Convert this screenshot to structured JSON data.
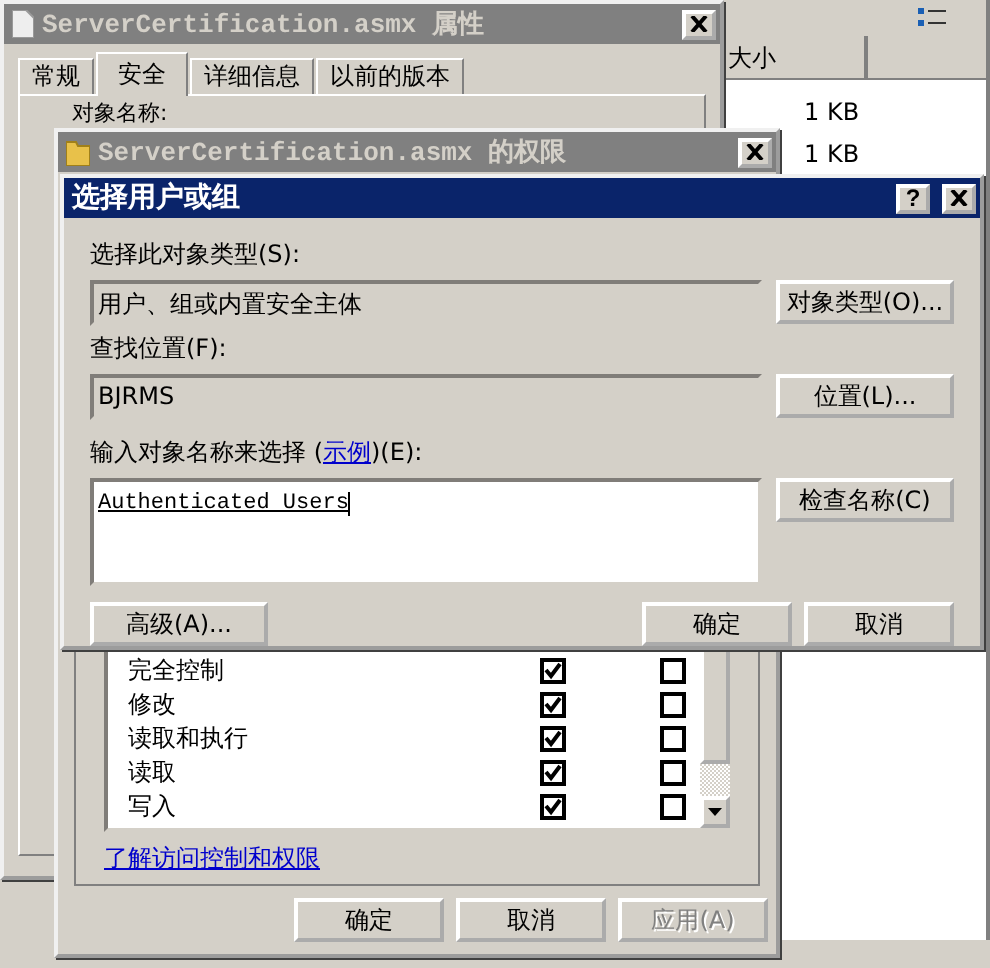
{
  "explorer": {
    "column": "大小",
    "rows": [
      "1 KB",
      "1 KB"
    ]
  },
  "properties_window": {
    "title": "ServerCertification.asmx 属性",
    "tabs": [
      {
        "label": "常规",
        "selected": false
      },
      {
        "label": "安全",
        "selected": true
      },
      {
        "label": "详细信息",
        "selected": false
      },
      {
        "label": "以前的版本",
        "selected": false
      }
    ],
    "object_name_label": "对象名称:"
  },
  "permissions_window": {
    "title": "ServerCertification.asmx 的权限",
    "permissions": [
      {
        "name": "完全控制",
        "allow": true,
        "deny": false
      },
      {
        "name": "修改",
        "allow": true,
        "deny": false
      },
      {
        "name": "读取和执行",
        "allow": true,
        "deny": false
      },
      {
        "name": "读取",
        "allow": true,
        "deny": false
      },
      {
        "name": "写入",
        "allow": true,
        "deny": false
      }
    ],
    "help_link": "了解访问控制和权限",
    "buttons": [
      {
        "label": "确定",
        "disabled": false
      },
      {
        "label": "取消",
        "disabled": false
      },
      {
        "label": "应用(A)",
        "disabled": true
      }
    ]
  },
  "select_dialog": {
    "title": "选择用户或组",
    "help_button": "?",
    "object_type_label": "选择此对象类型(S):",
    "object_type": "用户、组或内置安全主体",
    "object_type_button": "对象类型(O)...",
    "location_label": "查找位置(F):",
    "location": "BJRMS",
    "location_button": "位置(L)...",
    "names_label_before": "输入对象名称来选择 (",
    "names_label_link": "示例",
    "names_label_after": ")(E):",
    "names_value": "Authenticated Users",
    "check_names_button": "检查名称(C)",
    "advanced_button": "高级(A)...",
    "buttons": [
      "确定",
      "取消"
    ]
  }
}
